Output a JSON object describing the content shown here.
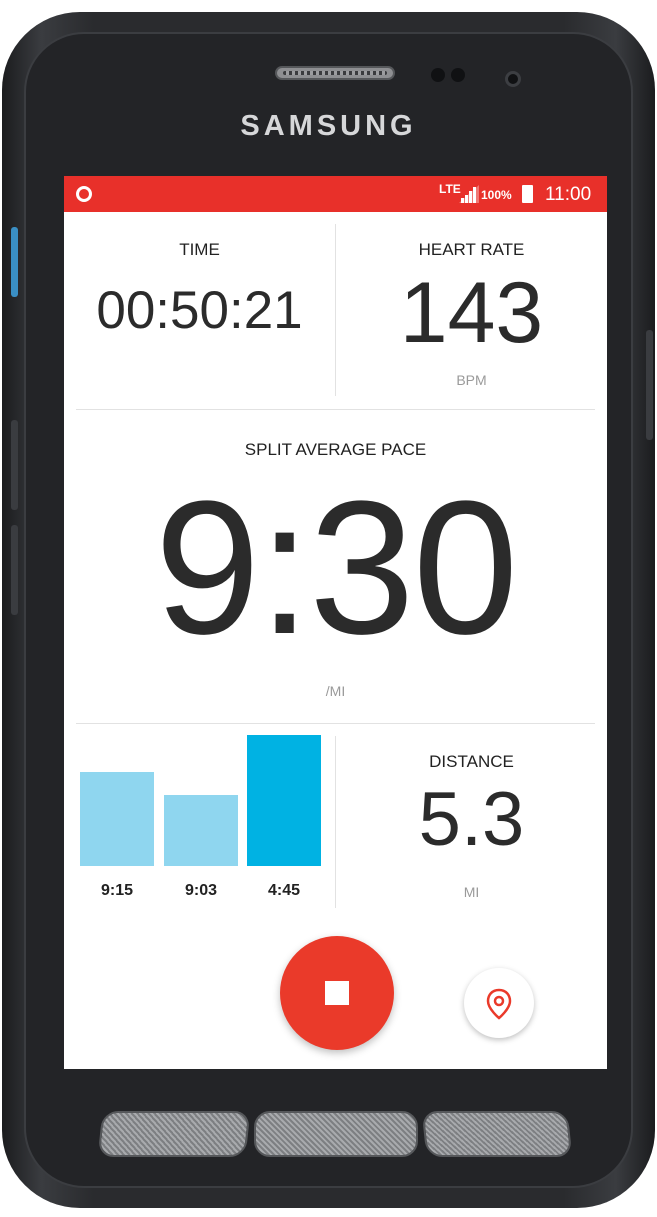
{
  "device": {
    "brand": "SAMSUNG"
  },
  "status_bar": {
    "network": "LTE",
    "battery": "100%",
    "time": "11:00"
  },
  "time_panel": {
    "label": "TIME",
    "value": "00:50:21"
  },
  "heart_panel": {
    "label": "HEART RATE",
    "value": "143",
    "unit": "BPM"
  },
  "pace_panel": {
    "label": "SPLIT AVERAGE PACE",
    "value": "9:30",
    "unit": "/MI"
  },
  "splits": {
    "bars": [
      {
        "label": "9:15",
        "color": "#8fd6ef"
      },
      {
        "label": "9:03",
        "color": "#8fd6ef"
      },
      {
        "label": "4:45",
        "color": "#00b2e3"
      }
    ]
  },
  "distance_panel": {
    "label": "DISTANCE",
    "value": "5.3",
    "unit": "MI"
  },
  "controls": {
    "stop_icon": "stop-icon",
    "location_icon": "location-pin-icon"
  },
  "colors": {
    "status_bar": "#e8302a",
    "stop_button": "#ea3a2a",
    "bar_light": "#8fd6ef",
    "bar_active": "#00b2e3"
  }
}
